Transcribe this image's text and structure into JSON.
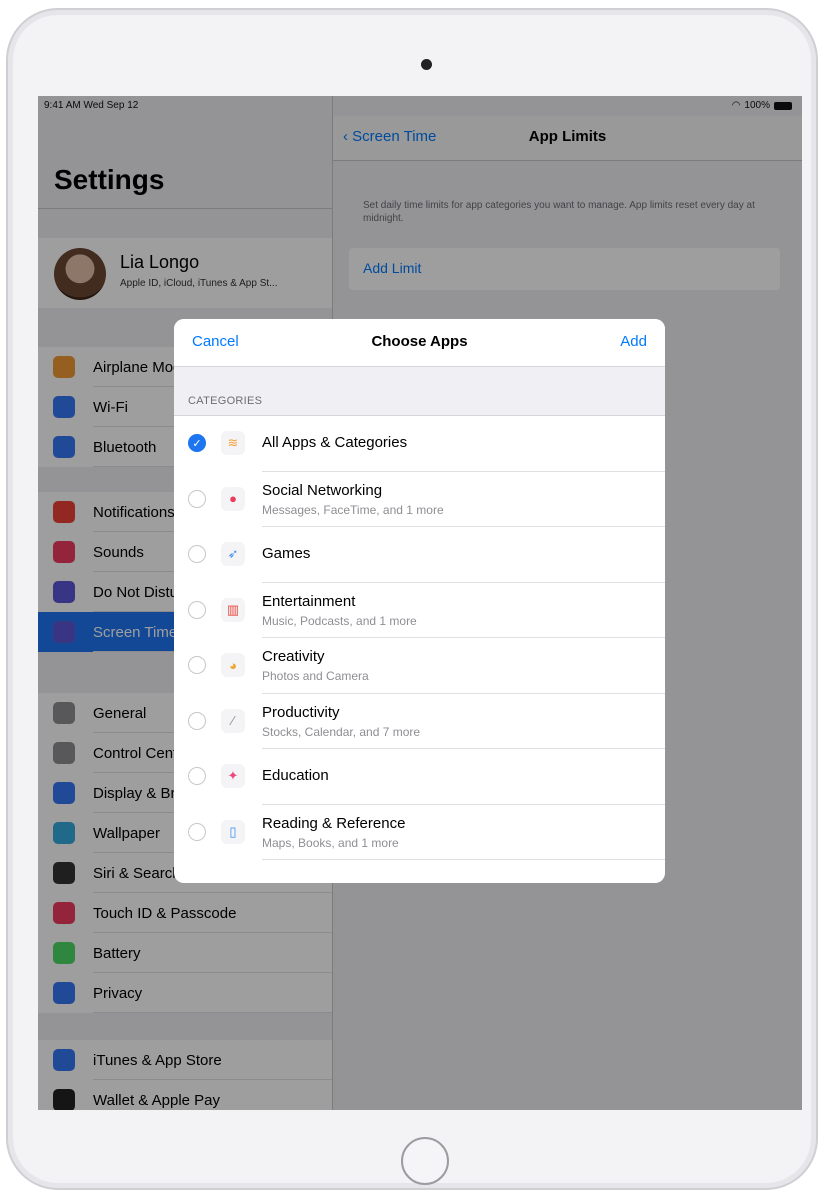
{
  "status": {
    "time": "9:41 AM  Wed Sep 12",
    "battery": "100%"
  },
  "sidebar": {
    "title": "Settings",
    "profile": {
      "name": "Lia Longo",
      "subtitle": "Apple ID, iCloud, iTunes & App St..."
    },
    "groups": [
      [
        {
          "label": "Airplane Mode",
          "icon": "airplane-icon",
          "color": "#f19a37"
        },
        {
          "label": "Wi-Fi",
          "icon": "wifi-icon",
          "color": "#3478f6"
        },
        {
          "label": "Bluetooth",
          "icon": "bluetooth-icon",
          "color": "#3478f6"
        }
      ],
      [
        {
          "label": "Notifications",
          "icon": "notifications-icon",
          "color": "#ee4038"
        },
        {
          "label": "Sounds",
          "icon": "sounds-icon",
          "color": "#ee3b5d"
        },
        {
          "label": "Do Not Disturb",
          "icon": "moon-icon",
          "color": "#5b56d6"
        },
        {
          "label": "Screen Time",
          "icon": "hourglass-icon",
          "color": "#5b56d6",
          "selected": true
        }
      ],
      [
        {
          "label": "General",
          "icon": "gear-icon",
          "color": "#8e8e93"
        },
        {
          "label": "Control Center",
          "icon": "control-center-icon",
          "color": "#8e8e93"
        },
        {
          "label": "Display & Brightness",
          "icon": "display-icon",
          "color": "#3478f6"
        },
        {
          "label": "Wallpaper",
          "icon": "wallpaper-icon",
          "color": "#35aadc"
        },
        {
          "label": "Siri & Search",
          "icon": "siri-icon",
          "color": "#333"
        },
        {
          "label": "Touch ID & Passcode",
          "icon": "fingerprint-icon",
          "color": "#ee3b5d"
        },
        {
          "label": "Battery",
          "icon": "battery-icon",
          "color": "#4cd964"
        },
        {
          "label": "Privacy",
          "icon": "hand-icon",
          "color": "#3478f6"
        }
      ],
      [
        {
          "label": "iTunes & App Store",
          "icon": "app-store-icon",
          "color": "#3478f6"
        },
        {
          "label": "Wallet & Apple Pay",
          "icon": "wallet-icon",
          "color": "#222"
        }
      ]
    ]
  },
  "detail": {
    "back": "Screen Time",
    "title": "App Limits",
    "description": "Set daily time limits for app categories you want to manage. App limits reset every day at midnight.",
    "add_limit": "Add Limit"
  },
  "modal": {
    "cancel": "Cancel",
    "title": "Choose Apps",
    "add": "Add",
    "section": "CATEGORIES",
    "items": [
      {
        "title": "All Apps & Categories",
        "subtitle": "",
        "checked": true,
        "icon": "stack-icon",
        "glyph": "≋",
        "color": "#f3a13c"
      },
      {
        "title": "Social Networking",
        "subtitle": "Messages, FaceTime, and 1 more",
        "checked": false,
        "icon": "chat-bubble-icon",
        "glyph": "●",
        "color": "#ee3b5d"
      },
      {
        "title": "Games",
        "subtitle": "",
        "checked": false,
        "icon": "rocket-icon",
        "glyph": "➶",
        "color": "#3b8ef0"
      },
      {
        "title": "Entertainment",
        "subtitle": "Music, Podcasts, and 1 more",
        "checked": false,
        "icon": "popcorn-icon",
        "glyph": "▥",
        "color": "#e8453c"
      },
      {
        "title": "Creativity",
        "subtitle": "Photos and Camera",
        "checked": false,
        "icon": "palette-icon",
        "glyph": "◕",
        "color": "#f0a52c"
      },
      {
        "title": "Productivity",
        "subtitle": "Stocks, Calendar, and 7 more",
        "checked": false,
        "icon": "pen-icon",
        "glyph": "⁄",
        "color": "#8e8e93"
      },
      {
        "title": "Education",
        "subtitle": "",
        "checked": false,
        "icon": "education-icon",
        "glyph": "✦",
        "color": "#e84a7a"
      },
      {
        "title": "Reading & Reference",
        "subtitle": "Maps, Books, and 1 more",
        "checked": false,
        "icon": "book-icon",
        "glyph": "▯",
        "color": "#3b8ef0"
      }
    ]
  }
}
